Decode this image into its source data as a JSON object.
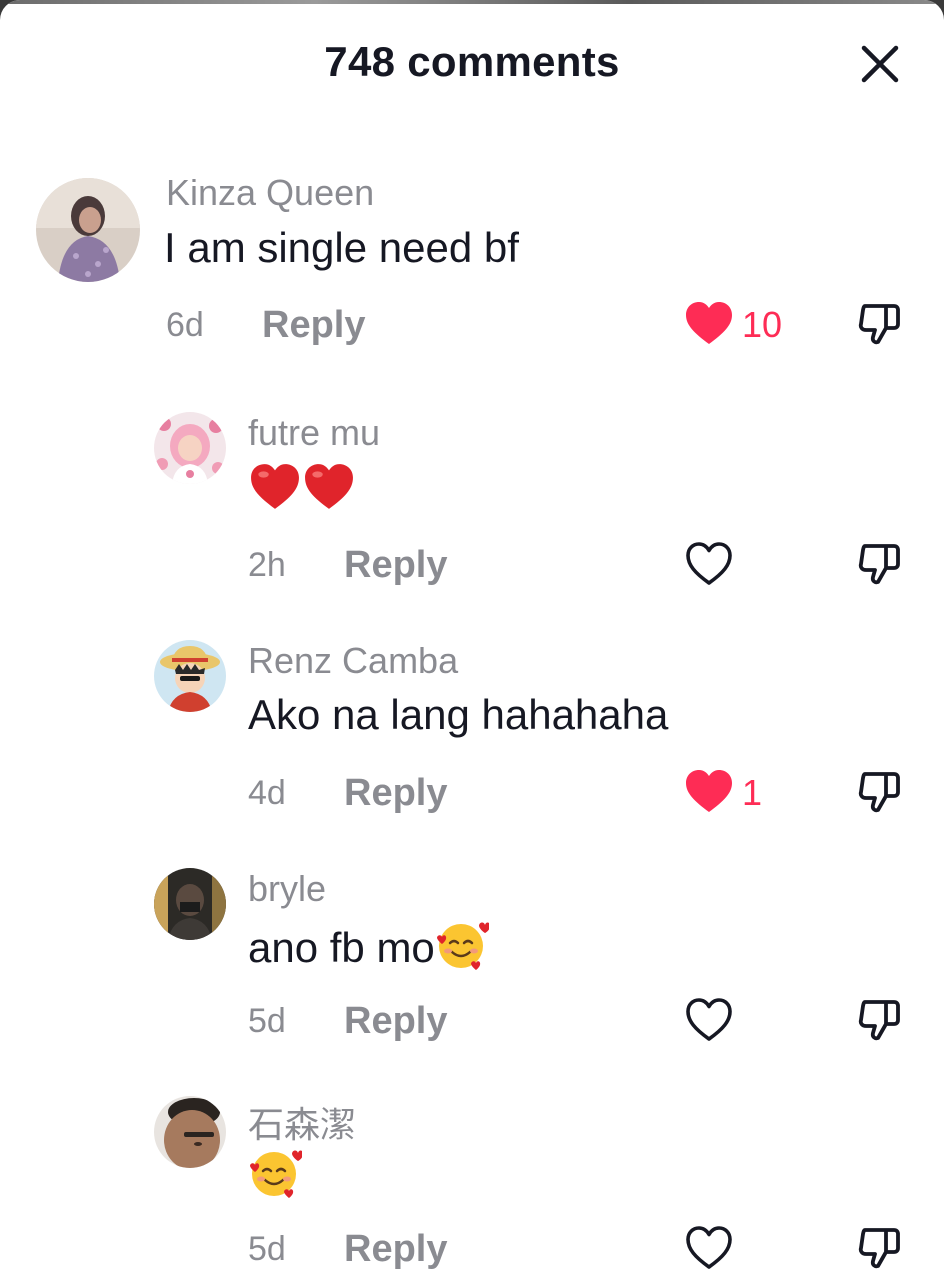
{
  "header": {
    "title": "748 comments"
  },
  "colors": {
    "like_active": "#fe2c55",
    "text": "#161823",
    "muted": "#8a8b91"
  },
  "comments": [
    {
      "username": "Kinza Queen",
      "text": "I am single need bf",
      "time": "6d",
      "reply_label": "Reply",
      "liked": true,
      "like_count": "10",
      "is_reply": false
    },
    {
      "username": "futre mu",
      "emoji": "❤️❤️",
      "time": "2h",
      "reply_label": "Reply",
      "liked": false,
      "like_count": "",
      "is_reply": true
    },
    {
      "username": "Renz Camba",
      "text": "Ako na lang hahahaha",
      "time": "4d",
      "reply_label": "Reply",
      "liked": true,
      "like_count": "1",
      "is_reply": true
    },
    {
      "username": "bryle",
      "text": "ano fb mo",
      "emoji": "🥰",
      "time": "5d",
      "reply_label": "Reply",
      "liked": false,
      "like_count": "",
      "is_reply": true
    },
    {
      "username": "石森潔",
      "emoji": "🥰",
      "time": "5d",
      "reply_label": "Reply",
      "liked": false,
      "like_count": "",
      "is_reply": true
    }
  ],
  "icons": {
    "close": "close-icon",
    "like_filled": "heart-filled-icon",
    "like_outline": "heart-outline-icon",
    "dislike": "thumbs-down-icon",
    "red_heart_emoji": "red-heart-emoji-icon",
    "smiling_hearts_emoji": "smiling-face-with-hearts-emoji-icon"
  }
}
